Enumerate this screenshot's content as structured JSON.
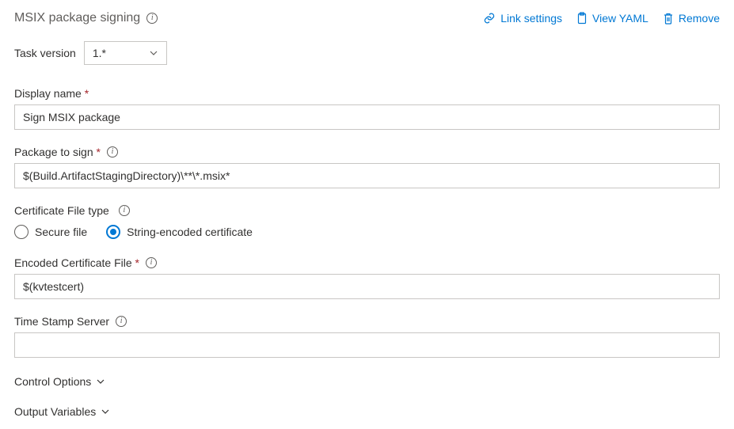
{
  "header": {
    "title": "MSIX package signing",
    "links": {
      "link_settings": "Link settings",
      "view_yaml": "View YAML",
      "remove": "Remove"
    }
  },
  "task_version": {
    "label": "Task version",
    "value": "1.*"
  },
  "fields": {
    "display_name": {
      "label": "Display name",
      "value": "Sign MSIX package"
    },
    "package_to_sign": {
      "label": "Package to sign",
      "value": "$(Build.ArtifactStagingDirectory)\\**\\*.msix*"
    },
    "certificate_file_type": {
      "label": "Certificate File type",
      "options": {
        "secure_file": "Secure file",
        "string_encoded": "String-encoded certificate"
      }
    },
    "encoded_certificate_file": {
      "label": "Encoded Certificate File",
      "value": "$(kvtestcert)"
    },
    "time_stamp_server": {
      "label": "Time Stamp Server",
      "value": ""
    }
  },
  "sections": {
    "control_options": "Control Options",
    "output_variables": "Output Variables"
  }
}
